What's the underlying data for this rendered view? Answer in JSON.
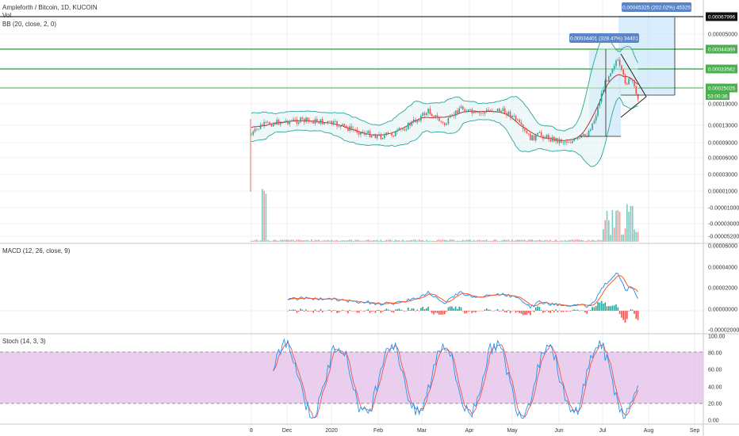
{
  "header": {
    "title": "Ampleforth / Bitcoin, 1D, KUCOIN",
    "vol_label": "Vol",
    "bb_label": "BB (20, close, 2, 0)",
    "macd_label": "MACD (12, 26, close, 9)",
    "stoch_label": "Stoch (14, 3, 3)"
  },
  "colors": {
    "up": "#26a69a",
    "down": "#ef5350",
    "bb": "#26a69a",
    "basis": "#b71c1c",
    "macd": "#2196f3",
    "signal": "#ff5722",
    "stoch_k": "#2196f3",
    "stoch_d": "#ef5350",
    "stoch_band": "#e1bee7",
    "level_line": "#4caf50",
    "measure_box": "#bbdefb",
    "label_blue": "#5b85c9",
    "label_green": "#4caf50"
  },
  "chart_data": [
    {
      "type": "candlestick",
      "title": "Ampleforth / Bitcoin, 1D, KUCOIN",
      "x_ticks": [
        "8",
        "Dec",
        "2020",
        "Feb",
        "Mar",
        "Apr",
        "May",
        "Jun",
        "Jul",
        "Aug",
        "Sep"
      ],
      "y_ticks": [
        "0.00005000",
        "0.00002200",
        "0.00019000",
        "0.00013000",
        "0.00009000",
        "0.00006000",
        "0.00003000",
        "0.00001000",
        "-0.00001000",
        "-0.00003000",
        "-0.00005200"
      ],
      "price_labels": [
        {
          "text": "0.00067996",
          "style": "black"
        },
        {
          "text": "0.00044369",
          "style": "green"
        },
        {
          "text": "0.00033562",
          "style": "green"
        },
        {
          "text": "0.00025025",
          "style": "green"
        },
        {
          "text": "53:00:36",
          "style": "green"
        }
      ],
      "measure_labels": [
        "0.00045325 (202.02%) 45325",
        "0.00034401 (328.47%) 34401"
      ],
      "overlays": [
        "Bollinger Bands (20, 2)"
      ]
    },
    {
      "type": "bar",
      "title": "Vol"
    },
    {
      "type": "line",
      "title": "MACD (12, 26, close, 9)",
      "series": [
        {
          "name": "MACD"
        },
        {
          "name": "Signal"
        },
        {
          "name": "Histogram"
        }
      ],
      "y_ticks": [
        "0.00006000",
        "0.00004000",
        "0.00002000",
        "0.00000000",
        "-0.00002000"
      ]
    },
    {
      "type": "line",
      "title": "Stoch (14, 3, 3)",
      "series": [
        {
          "name": "%K"
        },
        {
          "name": "%D"
        }
      ],
      "y_ticks": [
        "100.00",
        "80.00",
        "60.00",
        "40.00",
        "20.00",
        "0.00"
      ],
      "bands": [
        20,
        80
      ],
      "ylim": [
        0,
        100
      ]
    }
  ]
}
